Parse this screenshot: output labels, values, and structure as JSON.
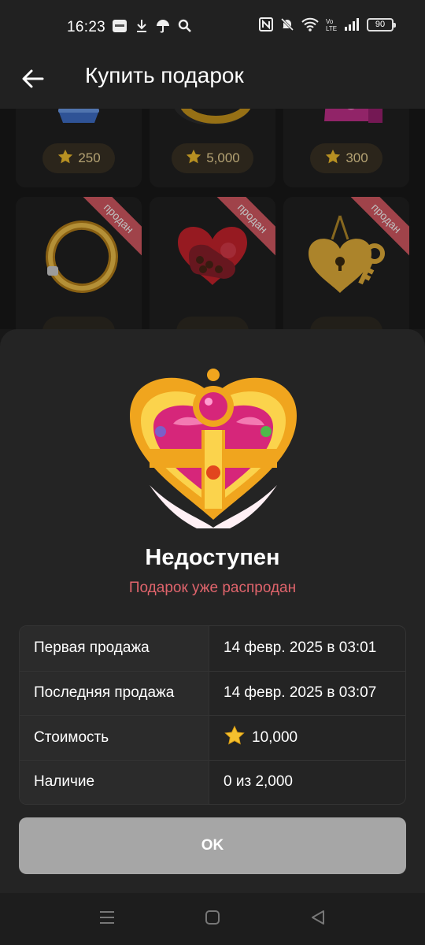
{
  "status_bar": {
    "time": "16:23",
    "battery": "90",
    "left_icons": [
      "news-icon",
      "download-icon",
      "umbrella-icon",
      "search-icon"
    ],
    "right_icons": [
      "nfc-icon",
      "mute-icon",
      "wifi-icon",
      "volte-icon",
      "signal-icon",
      "battery-icon"
    ]
  },
  "header": {
    "title": "Купить подарок",
    "back_icon": "arrow-left-icon"
  },
  "gift_grid": {
    "row1": [
      {
        "price": "250",
        "icon": "flower-pot-gift-icon"
      },
      {
        "price": "5,000",
        "icon": "ring-gift-icon"
      },
      {
        "price": "300",
        "icon": "pink-box-gift-icon"
      }
    ],
    "row2": [
      {
        "badge": "продан",
        "icon": "bracelet-gift-icon"
      },
      {
        "badge": "продан",
        "icon": "chocolate-heart-box-gift-icon"
      },
      {
        "badge": "продан",
        "icon": "heart-locket-key-gift-icon"
      }
    ]
  },
  "sheet": {
    "gift_icon": "heart-brooch-gift-icon",
    "title": "Недоступен",
    "subtitle": "Подарок уже распродан",
    "rows": [
      {
        "label": "Первая продажа",
        "value": "14 февр. 2025 в 03:01"
      },
      {
        "label": "Последняя продажа",
        "value": "14 февр. 2025 в 03:07"
      },
      {
        "label": "Стоимость",
        "value": "10,000",
        "icon": "star-icon"
      },
      {
        "label": "Наличие",
        "value": "0 из 2,000"
      }
    ],
    "ok_label": "OK"
  },
  "nav": {
    "menu_icon": "menu-icon",
    "home_icon": "home-square-icon",
    "back_icon": "back-triangle-icon"
  },
  "colors": {
    "accent_red": "#e0646c",
    "sheet_bg": "#242424",
    "ok_button": "#a6a6a6",
    "star": "#f5c02e"
  }
}
